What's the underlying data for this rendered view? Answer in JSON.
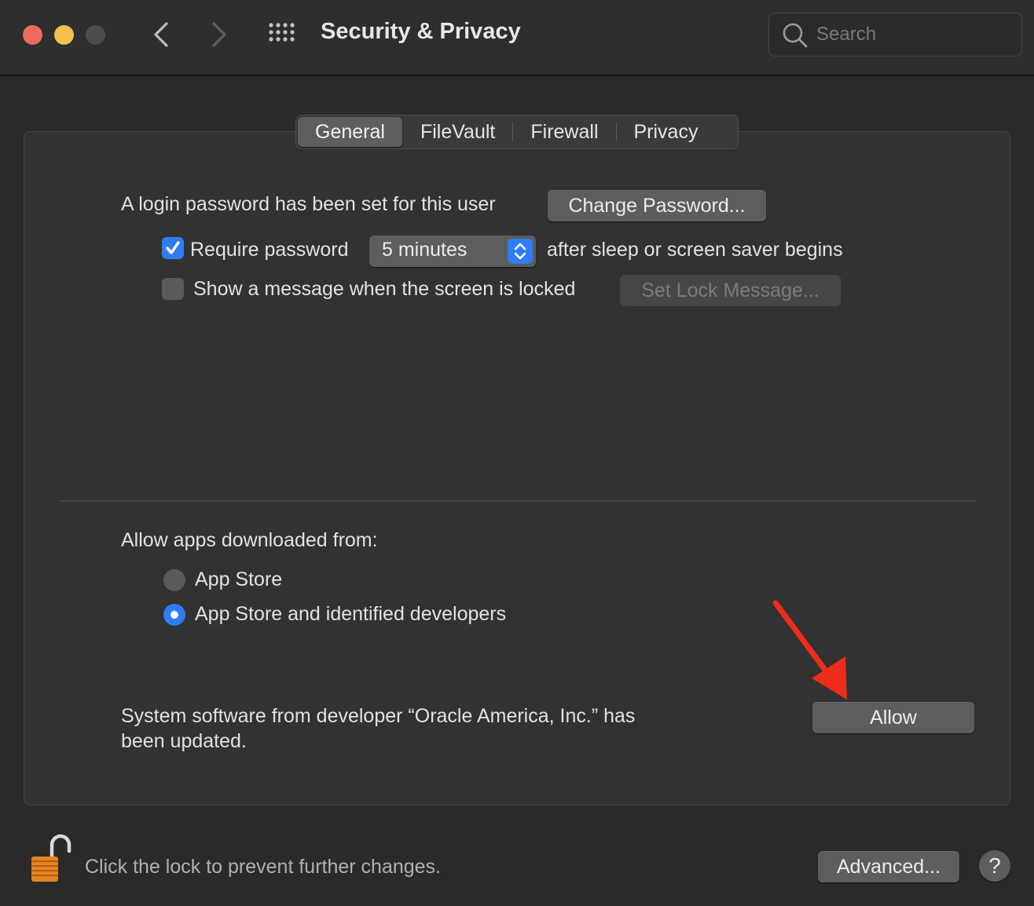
{
  "window": {
    "title": "Security & Privacy",
    "search_placeholder": "Search"
  },
  "tabs": [
    {
      "label": "General",
      "active": true
    },
    {
      "label": "FileVault",
      "active": false
    },
    {
      "label": "Firewall",
      "active": false
    },
    {
      "label": "Privacy",
      "active": false
    }
  ],
  "general": {
    "login_password_text": "A login password has been set for this user",
    "change_password_label": "Change Password...",
    "require_password_label": "Require password",
    "require_password_checked": true,
    "require_password_delay": "5 minutes",
    "after_sleep_text": "after sleep or screen saver begins",
    "show_message_label": "Show a message when the screen is locked",
    "show_message_checked": false,
    "set_lock_message_label": "Set Lock Message..."
  },
  "allow_apps": {
    "heading": "Allow apps downloaded from:",
    "options": [
      {
        "label": "App Store",
        "selected": false
      },
      {
        "label": "App Store and identified developers",
        "selected": true
      }
    ]
  },
  "system_software": {
    "line1": "System software from developer “Oracle America, Inc.” has",
    "line2": "been updated.",
    "allow_label": "Allow"
  },
  "footer": {
    "lock_text": "Click the lock to prevent further changes.",
    "advanced_label": "Advanced...",
    "help_label": "?"
  },
  "colors": {
    "accent": "#2f7df6",
    "annotation_arrow": "#ee2c1c",
    "close": "#ec6a5e",
    "minimize": "#f4bf4f"
  }
}
